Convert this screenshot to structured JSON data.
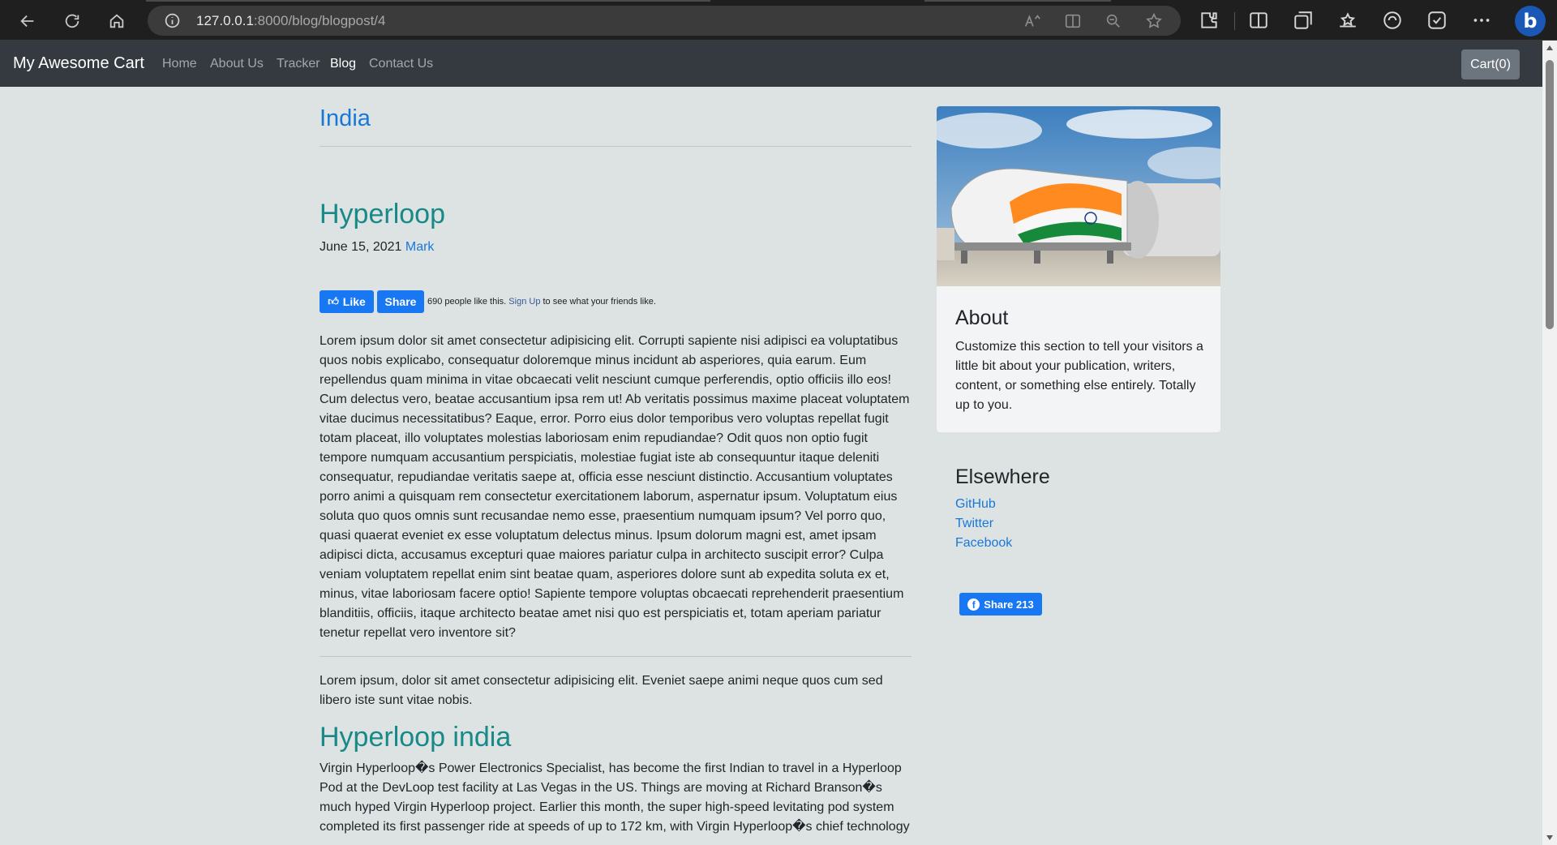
{
  "browser": {
    "url_host": "127.0.0.1",
    "url_path": ":8000/blog/blogpost/4",
    "bing_label": "b"
  },
  "navbar": {
    "brand": "My Awesome Cart",
    "links": [
      {
        "label": "Home",
        "active": false
      },
      {
        "label": "About Us",
        "active": false
      },
      {
        "label": "Tracker",
        "active": false
      },
      {
        "label": "Blog",
        "active": true
      },
      {
        "label": "Contact Us",
        "active": false
      }
    ],
    "cart_label": "Cart(0)"
  },
  "post": {
    "category": "India",
    "title": "Hyperloop",
    "date": "June 15, 2021",
    "author": "Mark",
    "fb_like_label": "Like",
    "fb_share_label": "Share",
    "fb_social_count": "690 people like this.",
    "fb_signup_link": "Sign Up",
    "fb_social_suffix": "to see what your friends like.",
    "paragraph_1": "Lorem ipsum dolor sit amet consectetur adipisicing elit. Corrupti sapiente nisi adipisci ea voluptatibus quos nobis explicabo, consequatur doloremque minus incidunt ab asperiores, quia earum. Eum repellendus quam minima in vitae obcaecati velit nesciunt cumque perferendis, optio officiis illo eos! Cum delectus vero, beatae accusantium ipsa rem ut! Ab veritatis possimus maxime placeat voluptatem vitae ducimus necessitatibus? Eaque, error. Porro eius dolor temporibus vero voluptas repellat fugit totam placeat, illo voluptates molestias laboriosam enim repudiandae? Odit quos non optio fugit tempore numquam accusantium perspiciatis, molestiae fugiat iste ab consequuntur itaque deleniti consequatur, repudiandae veritatis saepe at, officia esse nesciunt distinctio. Accusantium voluptates porro animi a quisquam rem consectetur exercitationem laborum, aspernatur ipsum. Voluptatum eius soluta quo quos omnis sunt recusandae nemo esse, praesentium numquam ipsum? Vel porro quo, quasi quaerat eveniet ex esse voluptatum delectus minus. Ipsum dolorum magni est, amet ipsam adipisci dicta, accusamus excepturi quae maiores pariatur culpa in architecto suscipit error? Culpa veniam voluptatem repellat enim sint beatae quam, asperiores dolore sunt ab expedita soluta ex et, minus, vitae laboriosam facere optio! Sapiente tempore voluptas obcaecati reprehenderit praesentium blanditiis, officiis, itaque architecto beatae amet nisi quo est perspiciatis et, totam aperiam pariatur tenetur repellat vero inventore sit?",
    "paragraph_2": "Lorem ipsum, dolor sit amet consectetur adipisicing elit. Eveniet saepe animi neque quos cum sed libero iste sunt vitae nobis.",
    "subheading": "Hyperloop india",
    "paragraph_3": "Virgin Hyperloop�s Power Electronics Specialist, has become the first Indian to travel in a Hyperloop Pod at the DevLoop test facility at Las Vegas in the US. Things are moving at Richard Branson�s much hyped Virgin Hyperloop project. Earlier this month, the super high-speed levitating pod system completed its first passenger ride at speeds of up to 172 km, with Virgin Hyperloop�s chief technology"
  },
  "sidebar": {
    "about_title": "About",
    "about_text": "Customize this section to tell your visitors a little bit about your publication, writers, content, or something else entirely. Totally up to you.",
    "elsewhere_title": "Elsewhere",
    "links": [
      "GitHub",
      "Twitter",
      "Facebook"
    ],
    "share_label": "Share 213"
  },
  "colors": {
    "page_bg": "#dde3e3",
    "link": "#1878d8",
    "heading_teal": "#178a88",
    "navbar": "#343a40",
    "facebook": "#1877f2"
  }
}
